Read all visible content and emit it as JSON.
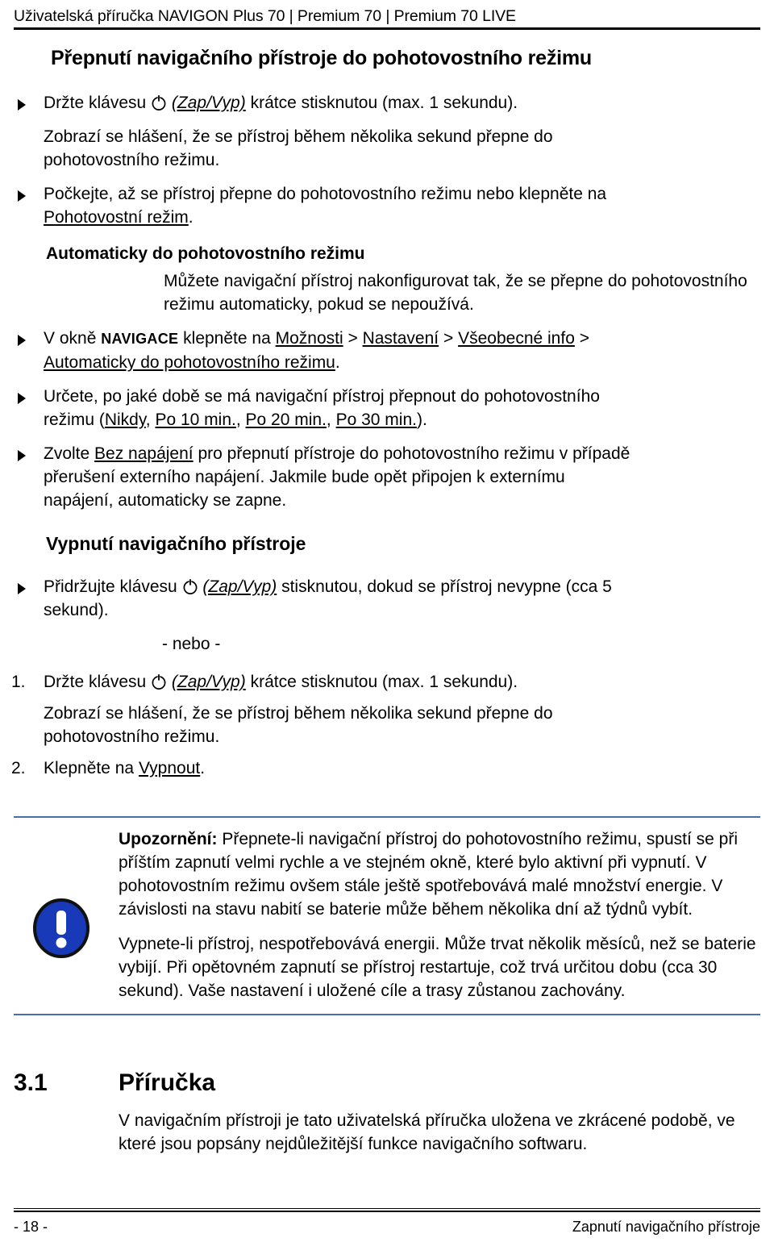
{
  "header": {
    "running_title": "Uživatelská příručka NAVIGON Plus 70 | Premium 70 | Premium 70 LIVE"
  },
  "page_title": "Přepnutí navigačního přístroje do pohotovostního režimu",
  "standby_steps": {
    "step1_pre": "Držte klávesu",
    "step1_label": "(Zap/Vyp)",
    "step1_post": "krátce stisknutou (max. 1 sekundu).",
    "step1_note": "Zobrazí se hlášení, že se přístroj během několika sekund přepne do pohotovostního režimu.",
    "step2_pre": "Počkejte, až se přístroj přepne do pohotovostního režimu nebo klepněte na",
    "step2_link": "Pohotovostní režim",
    "step2_post": "."
  },
  "auto_section": {
    "heading": "Automaticky do pohotovostního režimu",
    "intro": "Můžete navigační přístroj nakonfigurovat tak, že se přepne do pohotovostního režimu automaticky, pokud se nepoužívá.",
    "bullet1": {
      "pre": "V okně",
      "window_name": "Navigace",
      "mid": "klepněte na",
      "link1": "Možnosti",
      "sep1": ">",
      "link2": "Nastavení",
      "sep2": ">",
      "link3": "Všeobecné info",
      "sep3": ">",
      "link4": "Automaticky do pohotovostního režimu",
      "post": "."
    },
    "bullet2": {
      "pre": "Určete, po jaké době se má navigační přístroj přepnout do pohotovostního režimu (",
      "opt1": "Nikdy",
      "opt2": "Po 10 min.",
      "opt3": "Po 20 min.",
      "opt4": "Po 30 min.",
      "post": ")."
    },
    "bullet3": {
      "pre": "Zvolte",
      "link": "Bez napájení",
      "post": "pro přepnutí přístroje do pohotovostního režimu v případě přerušení externího napájení. Jakmile bude opět připojen k externímu napájení, automaticky se zapne."
    }
  },
  "shutdown_section": {
    "heading": "Vypnutí navigačního přístroje",
    "bullet1_pre": "Přidržujte klávesu",
    "bullet1_label": "(Zap/Vyp)",
    "bullet1_post": "stisknutou, dokud se přístroj nevypne (cca 5 sekund).",
    "or_text": "- nebo -",
    "item1_num": "1.",
    "item1_pre": "Držte klávesu",
    "item1_label": "(Zap/Vyp)",
    "item1_post": "krátce stisknutou (max. 1 sekundu).",
    "item1_note": "Zobrazí se hlášení, že se přístroj během několika sekund přepne do pohotovostního režimu.",
    "item2_num": "2.",
    "item2_pre": "Klepněte na",
    "item2_link": "Vypnout",
    "item2_post": "."
  },
  "note": {
    "label": "Upozornění:",
    "paragraph1": " Přepnete-li navigační přístroj do pohotovostního režimu, spustí se při příštím zapnutí velmi rychle a ve stejném okně, které bylo aktivní při vypnutí. V pohotovostním režimu ovšem stále ještě spotřebovává malé množství energie. V závislosti na stavu nabití se baterie může během několika dní až týdnů vybít.",
    "paragraph2": "Vypnete-li přístroj, nespotřebovává energii. Může trvat několik měsíců, než se baterie vybijí. Při opětovném zapnutí se přístroj restartuje, což trvá určitou dobu (cca 30 sekund). Vaše nastavení i uložené cíle a trasy zůstanou zachovány.",
    "icon_color": "#1839b8",
    "rule_color": "#4a6fa8"
  },
  "section_31": {
    "number": "3.1",
    "title": "Příručka",
    "body": "V navigačním přístroji je tato uživatelská příručka uložena ve zkrácené podobě, ve které jsou popsány nejdůležitější funkce navigačního softwaru."
  },
  "footer": {
    "page_number": "- 18 -",
    "running_footer": "Zapnutí navigačního přístroje"
  }
}
